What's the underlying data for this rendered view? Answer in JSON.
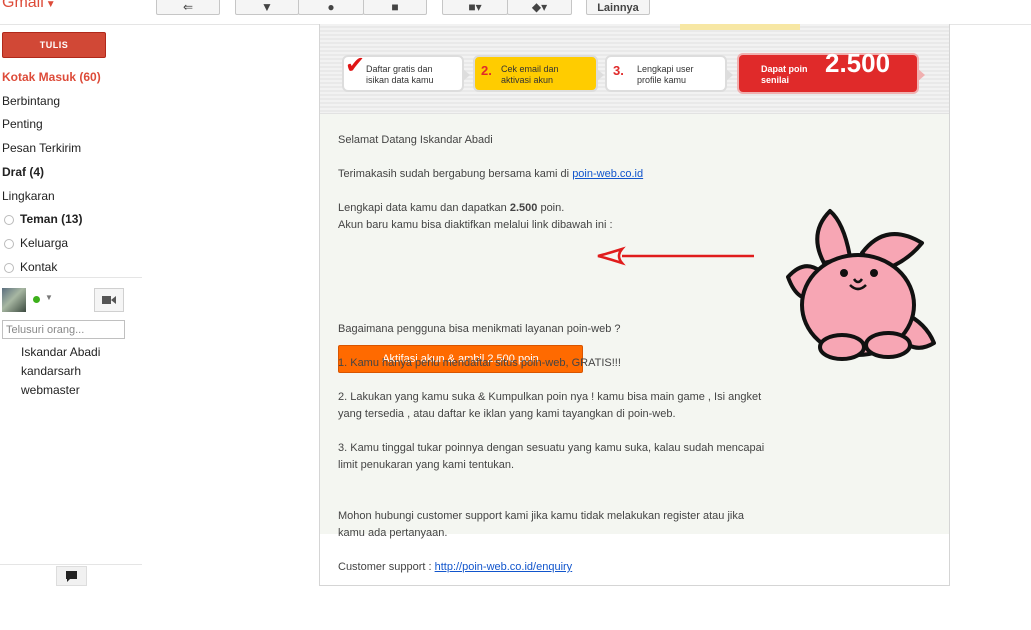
{
  "topbar": {
    "logo": "Gmail",
    "more_label": "Lainnya"
  },
  "sidebar": {
    "compose_label": "TULIS",
    "inbox": "Kotak Masuk (60)",
    "items": [
      "Berbintang",
      "Penting",
      "Pesan Terkirim"
    ],
    "drafts": "Draf (4)",
    "circles_label": "Lingkaran",
    "circles": [
      {
        "name": "Teman (13)",
        "bold": true
      },
      {
        "name": "Keluarga",
        "bold": false
      },
      {
        "name": "Kontak",
        "bold": false
      }
    ],
    "search_placeholder": "Telusuri orang...",
    "contacts": [
      "Iskandar Abadi",
      "kandarsarh",
      "webmaster"
    ]
  },
  "banner": {
    "step1": "Daftar gratis dan isikan data kamu",
    "step2_num": "2.",
    "step2": "Cek email dan aktivasi akun",
    "step3_num": "3.",
    "step3": "Lengkapi user profile kamu",
    "step4_label": "Dapat poin senilai",
    "step4_value": "2.500",
    "colors": {
      "accent_red": "#e02a2a",
      "step_yellow": "#ffcc00"
    }
  },
  "email": {
    "greeting": "Selamat Datang Iskandar Abadi",
    "thanks_prefix": "Terimakasih sudah bergabung bersama kami di ",
    "thanks_link": "poin-web.co.id",
    "complete_prefix": "Lengkapi data kamu dan dapatkan ",
    "complete_bold": "2.500",
    "complete_suffix": " poin.",
    "activate_note": "Akun baru kamu bisa diaktifkan melalui link dibawah ini :",
    "activate_button": "Aktifasi akun & ambil 2.500 poin",
    "button_color": "#ff6a00",
    "question": "Bagaimana pengguna bisa menikmati layanan poin-web ?",
    "point1": "1. Kamu hanya perlu mendaftar situs poin-web, GRATIS!!!",
    "point2_line1": "2. Lakukan yang kamu suka & Kumpulkan poin nya ! kamu bisa main game , Isi angket",
    "point2_line2": "yang tersedia , atau daftar ke iklan yang kami tayangkan di poin-web.",
    "point3_line1": "3. Kamu tinggal tukar poinnya dengan sesuatu yang kamu suka, kalau sudah mencapai",
    "point3_line2": "limit penukaran yang kami tentukan.",
    "contact_line1": "Mohon hubungi customer support kami jika kamu tidak melakukan register atau jika",
    "contact_line2": "kamu ada pertanyaan.",
    "support_prefix": "Customer support : ",
    "support_link": "http://poin-web.co.id/enquiry"
  }
}
